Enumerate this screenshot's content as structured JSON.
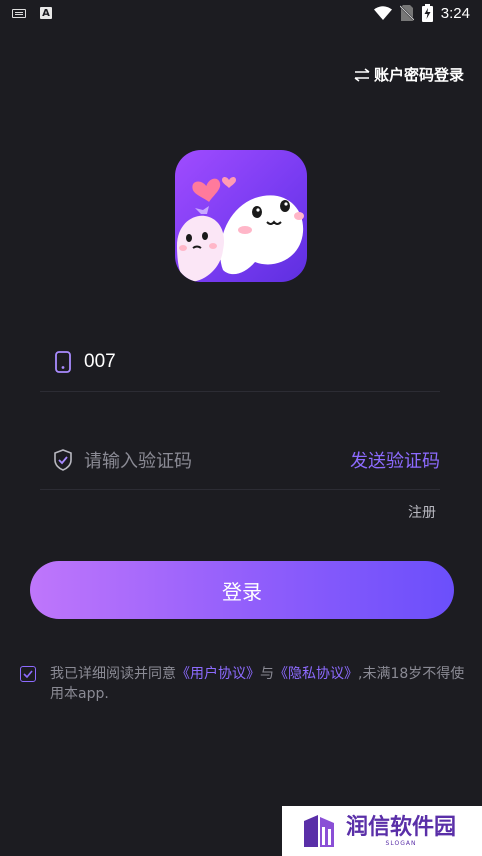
{
  "status_bar": {
    "time": "3:24"
  },
  "header": {
    "switch_login": "账户密码登录"
  },
  "form": {
    "phone_value": "007",
    "code_placeholder": "请输入验证码",
    "send_code": "发送验证码",
    "register": "注册",
    "login_button": "登录"
  },
  "agreement": {
    "text_prefix": "我已详细阅读并同意",
    "user_agreement": "《用户协议》",
    "conjunction": "与",
    "privacy_agreement": "《隐私协议》",
    "text_suffix": ",未满18岁不得使用本app.",
    "checked": true
  },
  "watermark": {
    "title": "润信软件园",
    "slogan": "SLOGAN"
  },
  "colors": {
    "accent": "#8d6bff",
    "background": "#1c1c21"
  }
}
